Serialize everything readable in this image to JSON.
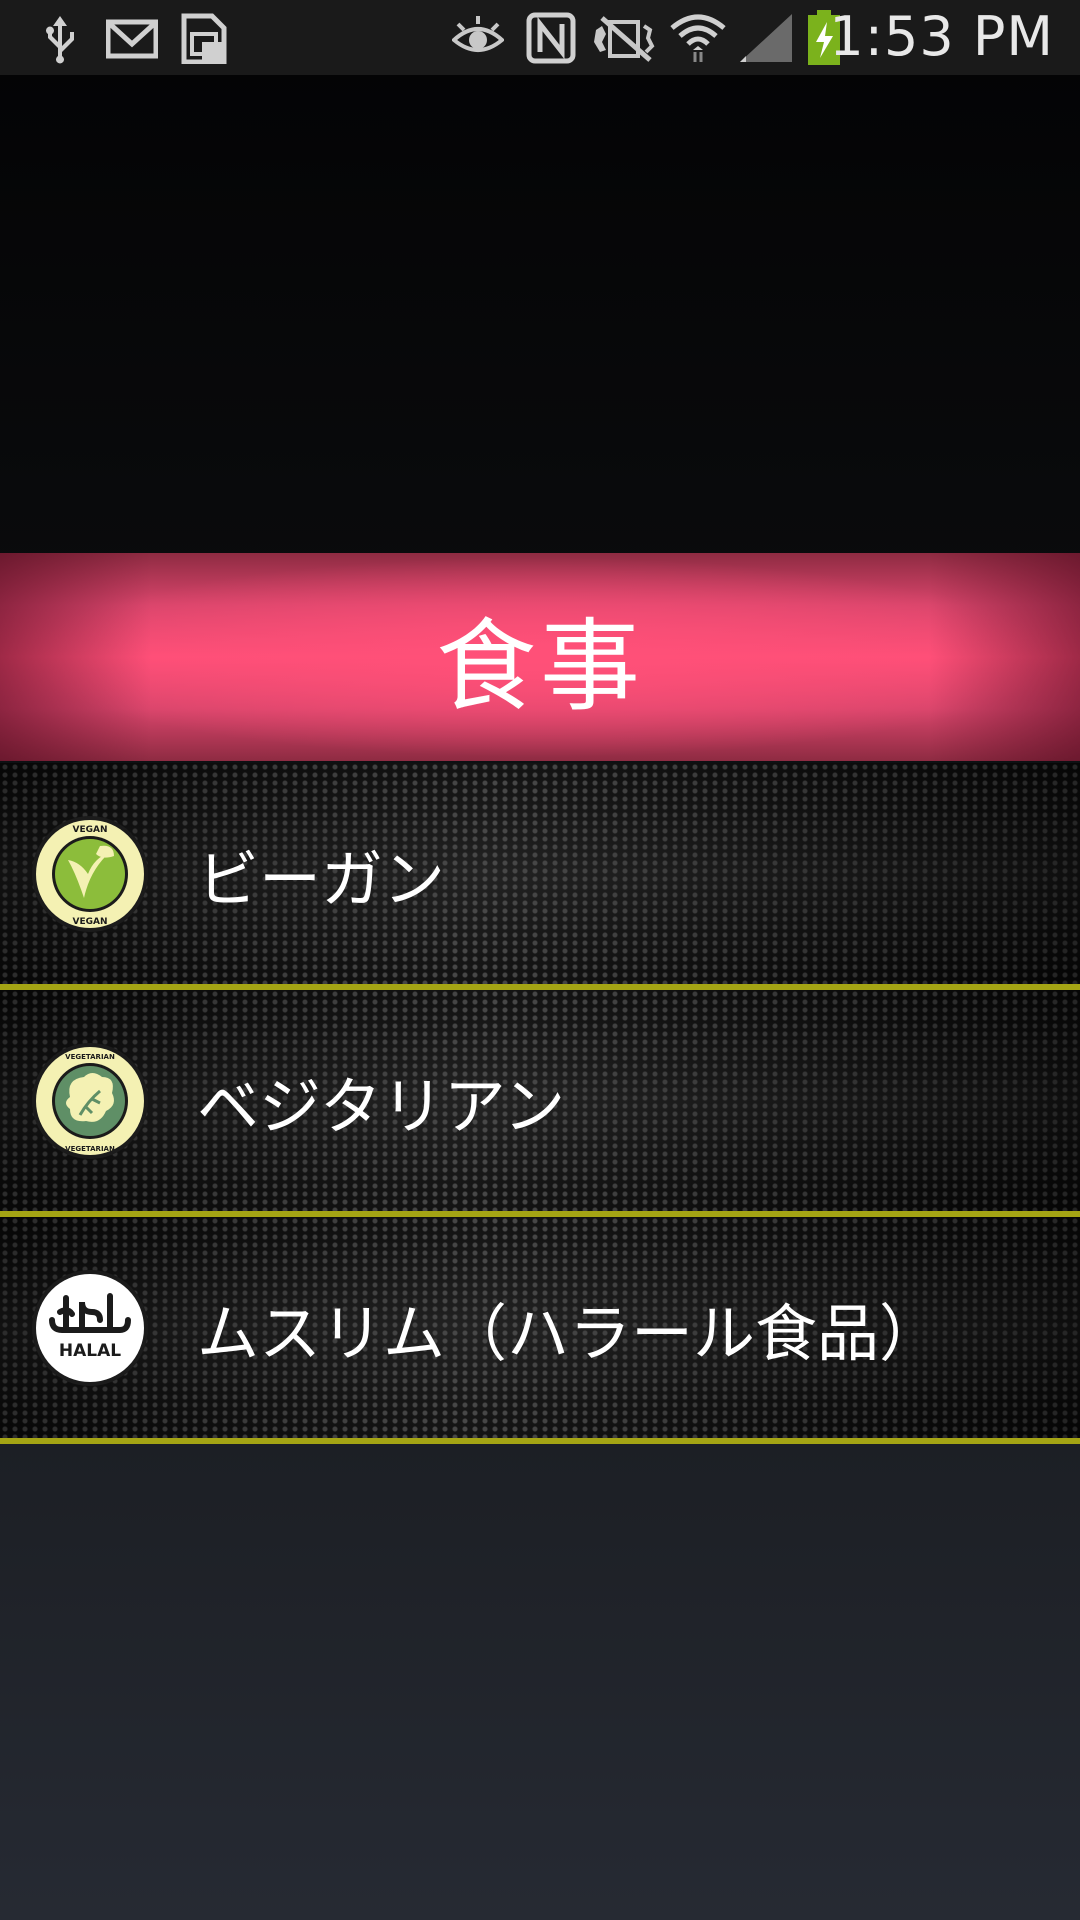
{
  "status_bar": {
    "time": "1:53 PM",
    "left_icons": [
      "usb-icon",
      "gmail-icon",
      "sim-card-icon"
    ],
    "right_icons": [
      "eye-icon",
      "nfc-icon",
      "mute-icon",
      "wifi-icon",
      "signal-icon",
      "battery-charging-icon"
    ],
    "battery_color": "#7bb21c"
  },
  "header": {
    "title": "食事",
    "color": "#ff4f78"
  },
  "menu": {
    "separator_color": "#a4a414",
    "items": [
      {
        "label": "ビーガン",
        "icon": "vegan-badge-icon",
        "badge_text_top": "VEGAN",
        "badge_text_bottom": "VEGAN"
      },
      {
        "label": "ベジタリアン",
        "icon": "vegetarian-badge-icon",
        "badge_text_top": "VEGETARIAN",
        "badge_text_bottom": "VEGETARIAN"
      },
      {
        "label": "ムスリム（ハラール食品）",
        "icon": "halal-badge-icon",
        "badge_text_bottom": "HALAL"
      }
    ]
  }
}
